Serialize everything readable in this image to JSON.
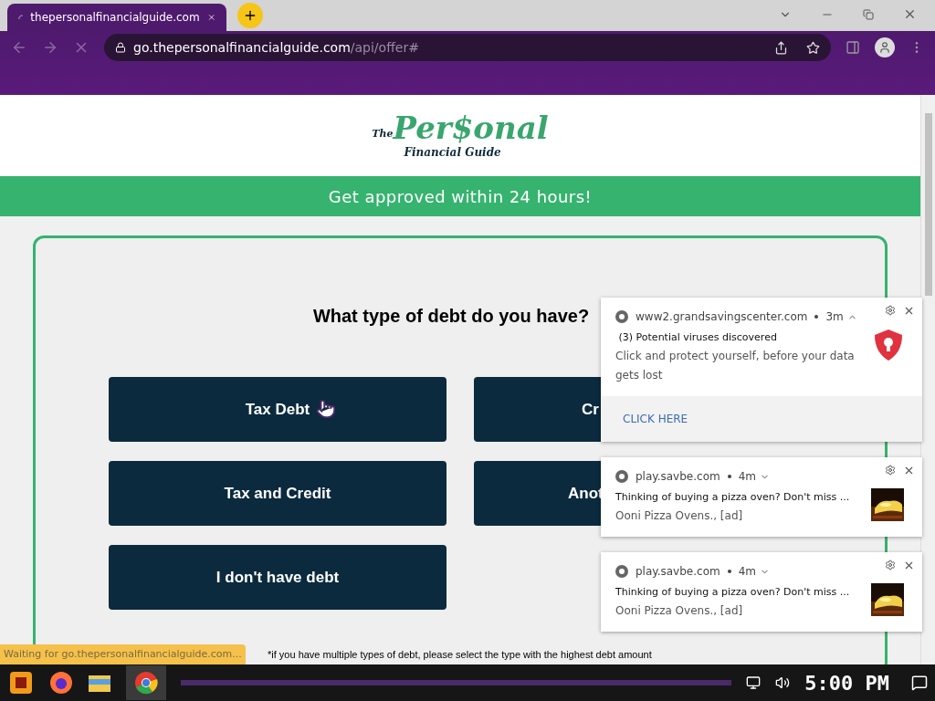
{
  "browser": {
    "tab": {
      "title": "thepersonalfinancialguide.com"
    },
    "url": {
      "host": "go.thepersonalfinancialguide.com",
      "path": "/api/offer#"
    },
    "status": "Waiting for go.thepersonalfinancialguide.com..."
  },
  "page": {
    "logo": {
      "prefix": "The",
      "main": "Per$onal",
      "sub": "Financial Guide"
    },
    "banner": "Get approved within 24 hours!",
    "question": "What type of debt do you have?",
    "options": [
      {
        "label": "Tax Debt",
        "covered": false
      },
      {
        "label": "Cr",
        "covered": true
      },
      {
        "label": "Tax and Credit",
        "covered": false
      },
      {
        "label": "Anot",
        "covered": true
      },
      {
        "label": "I don't have debt",
        "covered": false
      }
    ],
    "footnote": "*if you have multiple types of debt, please select the type with the highest debt amount"
  },
  "notifications": [
    {
      "kind": "alert",
      "source": "www2.grandsavingscenter.com",
      "time": "3m",
      "expanded": true,
      "title": " (3) Potential viruses discovered",
      "body": "Click and protect yourself, before your data gets lost",
      "action": "CLICK HERE"
    },
    {
      "kind": "ad",
      "source": "play.savbe.com",
      "time": "4m",
      "expanded": false,
      "title": "Thinking of buying a pizza oven? Don't miss ...",
      "body": "Ooni Pizza Ovens., [ad]"
    },
    {
      "kind": "ad",
      "source": "play.savbe.com",
      "time": "4m",
      "expanded": false,
      "title": "Thinking of buying a pizza oven? Don't miss ...",
      "body": "Ooni Pizza Ovens., [ad]"
    }
  ],
  "taskbar": {
    "clock": "5:00 PM"
  }
}
